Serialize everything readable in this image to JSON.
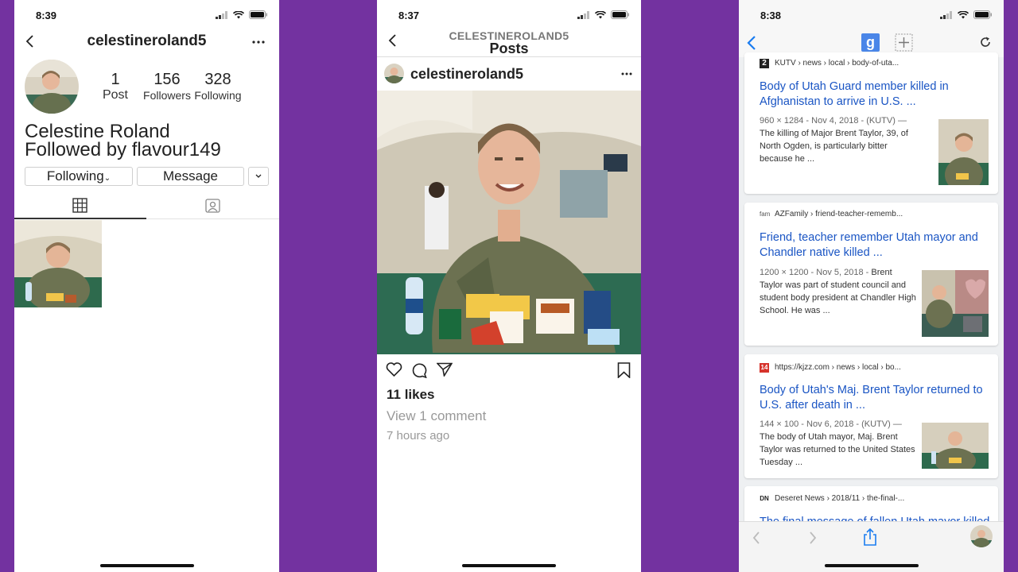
{
  "colors": {
    "background": "#7332a0",
    "link_blue": "#1a55c4",
    "ios_blue": "#1a7cf0"
  },
  "profile": {
    "status_time": "8:39",
    "username": "celestineroland5",
    "posts_count": "1",
    "posts_label": "Post",
    "followers_count": "156",
    "followers_label": "Followers",
    "following_count": "328",
    "following_label": "Following",
    "full_name": "Celestine Roland",
    "followed_by_prefix": "Followed by",
    "followed_by_user": "flavour149",
    "following_button": "Following",
    "message_button": "Message"
  },
  "post": {
    "status_time": "8:37",
    "header_username": "CELESTINEROLAND5",
    "header_title": "Posts",
    "username": "celestineroland5",
    "likes": "11 likes",
    "view_comments": "View 1 comment",
    "time_ago": "7 hours ago"
  },
  "search": {
    "status_time": "8:38",
    "results": [
      {
        "source": "KUTV › news › local › body-of-uta...",
        "source_icon": "2",
        "title": "Body of Utah Guard member killed in Afghanistan to arrive in U.S. ...",
        "meta": "960 × 1284 - Nov 4, 2018 - (KUTV) — ",
        "snippet": "The killing of Major Brent Taylor, 39, of North Ogden, is particularly bitter because he ..."
      },
      {
        "source": "AZFamily › friend-teacher-rememb...",
        "source_icon": "fam",
        "title": "Friend, teacher remember Utah mayor and Chandler native killed ...",
        "meta": "1200 × 1200 - Nov 5, 2018 - ",
        "snippet": "Brent Taylor was part of student council and student body president at Chandler High School. He was ..."
      },
      {
        "source": "https://kjzz.com › news › local › bo...",
        "source_icon": "14",
        "title": "Body of Utah's Maj. Brent Taylor returned to U.S. after death in ...",
        "meta": "144 × 100 - Nov 6, 2018 - (KUTV) — ",
        "snippet": "The body of Utah mayor, Maj. Brent Taylor was returned to the United States Tuesday ..."
      },
      {
        "source": "Deseret News › 2018/11 › the-final-...",
        "source_icon": "DN",
        "title": "The final message of fallen Utah mayor killed",
        "meta": "",
        "snippet": ""
      }
    ]
  }
}
